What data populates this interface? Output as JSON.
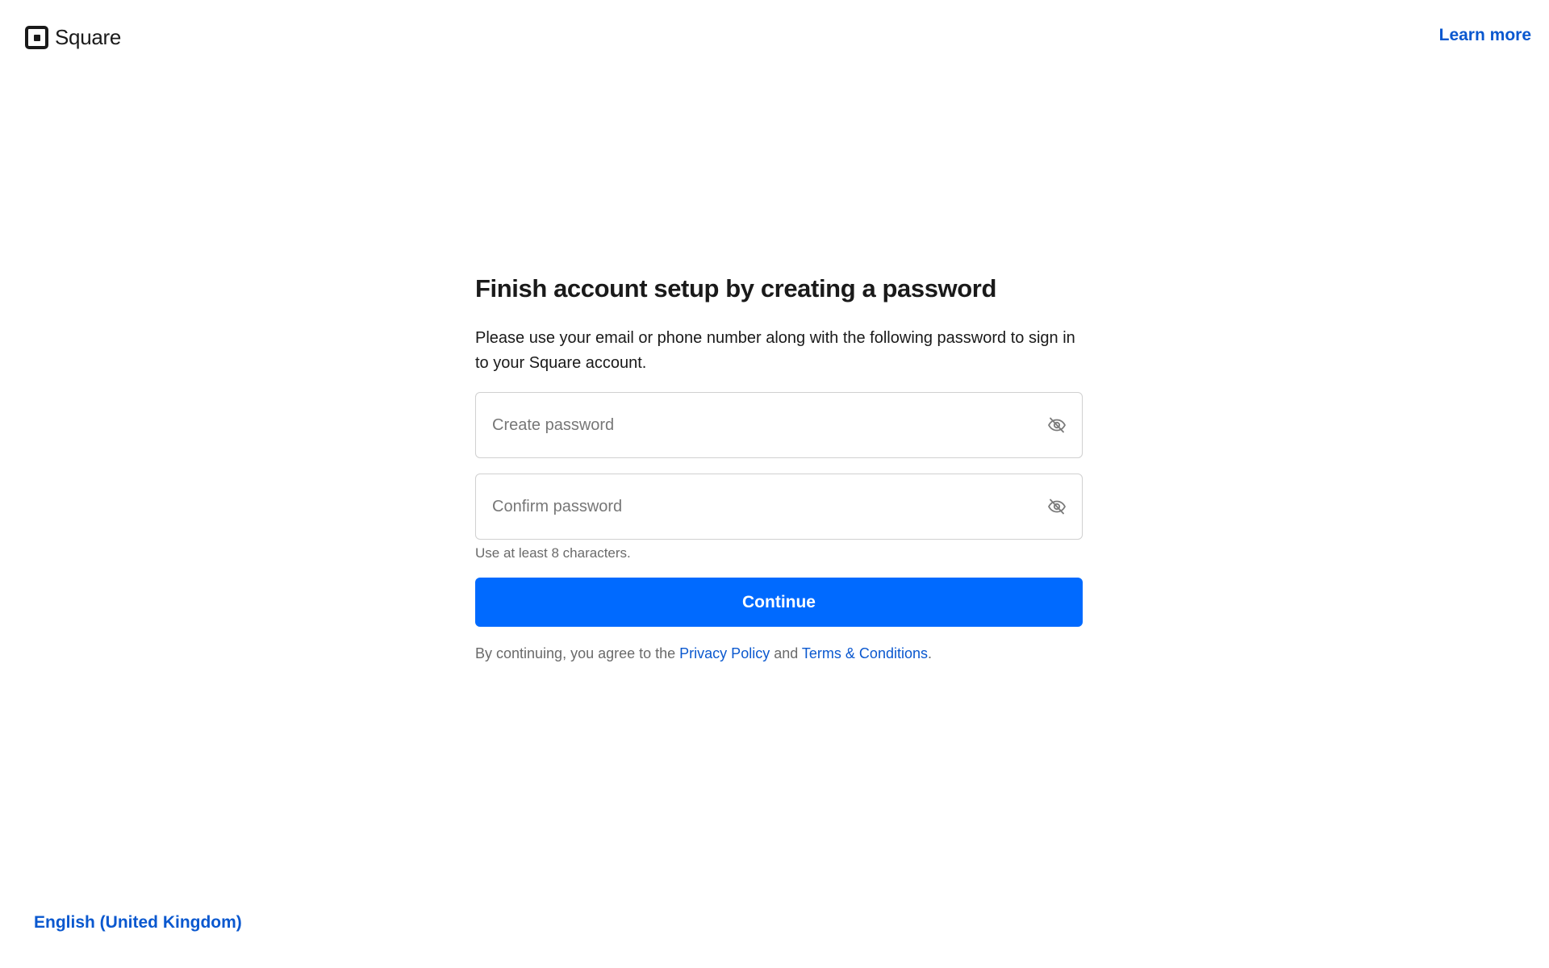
{
  "header": {
    "brand_name": "Square",
    "learn_more_label": "Learn more"
  },
  "form": {
    "title": "Finish account setup by creating a password",
    "description": "Please use your email or phone number along with the following password to sign in to your Square account.",
    "create_password": {
      "value": "",
      "placeholder": "Create password"
    },
    "confirm_password": {
      "value": "",
      "placeholder": "Confirm password"
    },
    "hint": "Use at least 8 characters.",
    "continue_label": "Continue",
    "legal": {
      "prefix": "By continuing, you agree to the ",
      "privacy_label": "Privacy Policy",
      "middle": " and ",
      "terms_label": "Terms & Conditions",
      "suffix": "."
    }
  },
  "footer": {
    "language_label": "English (United Kingdom)"
  },
  "icons": {
    "logo": "square-logo-icon",
    "toggle_visibility": "eye-slash-icon"
  },
  "colors": {
    "accent": "#006aff",
    "link": "#0a58cf",
    "text": "#1a1a1a",
    "muted": "#6a6a6a",
    "border": "#d0d0d0"
  }
}
